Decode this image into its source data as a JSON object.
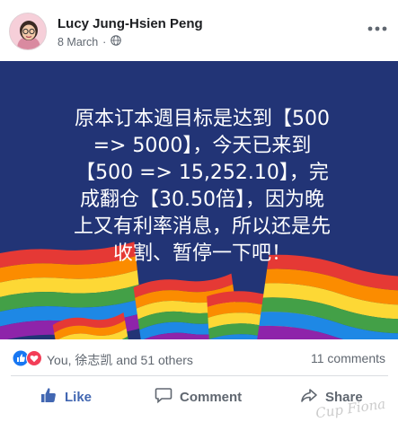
{
  "post": {
    "author": "Lucy Jung-Hsien Peng",
    "date": "8 March",
    "separator": "·",
    "audience_icon": "globe-icon",
    "more_icon": "ellipsis-icon",
    "text_lines": [
      "原本订本週目标是达到【500",
      "=> 5000】，今天已来到",
      "【500 => 15,252.10】，完",
      "成翻仓【30.50倍】，因为晚",
      "上又有利率消息，所以还是先",
      "收割、暂停一下吧！"
    ],
    "background_color": "#223476",
    "flag_colors": [
      "#e53935",
      "#fb8c00",
      "#fdd835",
      "#43a047",
      "#1e88e5",
      "#8e24aa"
    ]
  },
  "reactions": {
    "icons": [
      "thumbs-up-icon",
      "heart-icon"
    ],
    "names": "You, 徐志凯 and 51 others",
    "comments": "11 comments"
  },
  "actions": {
    "like": "Like",
    "comment": "Comment",
    "share": "Share"
  },
  "watermark": "Cup Fiona"
}
